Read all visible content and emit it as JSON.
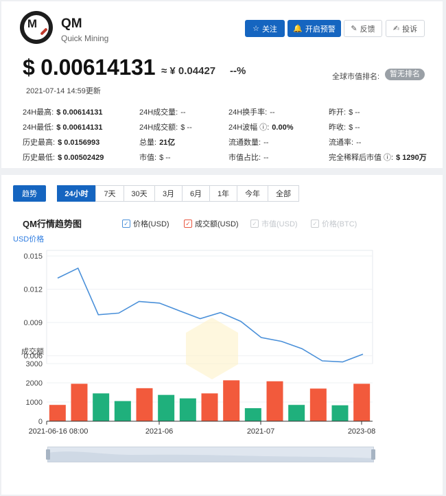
{
  "coin": {
    "symbol": "QM",
    "name": "Quick Mining",
    "logo_letter": "M"
  },
  "actions": [
    {
      "label": "关注",
      "icon": "☆",
      "name": "follow-button",
      "icon_name": "star-icon",
      "primary": true
    },
    {
      "label": "开启预警",
      "icon": "🔔",
      "name": "alert-button",
      "icon_name": "bell-icon",
      "primary": true
    },
    {
      "label": "反馈",
      "icon": "✎",
      "name": "feedback-button",
      "icon_name": "edit-icon",
      "primary": false
    },
    {
      "label": "投诉",
      "icon": "✍",
      "name": "complaint-button",
      "icon_name": "pen-icon",
      "primary": false
    }
  ],
  "price": {
    "usd": "$ 0.00614131",
    "cny": "≈ ¥ 0.04427",
    "change": "--%",
    "updated": "2021-07-14 14:59更新"
  },
  "rank": {
    "label": "全球市值排名:",
    "value": "暂无排名"
  },
  "stats": [
    [
      {
        "label": "24H最高:",
        "value": "$ 0.00614131",
        "bold": true
      },
      {
        "label": "24H成交量:",
        "value": "--"
      },
      {
        "label": "24H换手率:",
        "value": "--"
      },
      {
        "label": "昨开:",
        "value": "$ --"
      }
    ],
    [
      {
        "label": "24H最低:",
        "value": "$ 0.00614131",
        "bold": true
      },
      {
        "label": "24H成交额:",
        "value": "$ --"
      },
      {
        "label": "24H波幅 ⓘ:",
        "value": "0.00%",
        "bold": true
      },
      {
        "label": "昨收:",
        "value": "$ --"
      }
    ],
    [
      {
        "label": "历史最高:",
        "value": "$ 0.0156993",
        "bold": true
      },
      {
        "label": "总量:",
        "value": "21亿",
        "bold": true
      },
      {
        "label": "流通数量:",
        "value": "--"
      },
      {
        "label": "流通率:",
        "value": "--"
      }
    ],
    [
      {
        "label": "历史最低:",
        "value": "$ 0.00502429",
        "bold": true
      },
      {
        "label": "市值:",
        "value": "$ --"
      },
      {
        "label": "市值占比:",
        "value": "--"
      },
      {
        "label": "完全稀释后市值 ⓘ:",
        "value": "$ 1290万",
        "bold": true
      }
    ]
  ],
  "chart_tab": "趋势",
  "ranges": [
    "24小时",
    "7天",
    "30天",
    "3月",
    "6月",
    "1年",
    "今年",
    "全部"
  ],
  "active_range": "24小时",
  "chart_title": "QM行情趋势图",
  "legend": [
    {
      "label": "价格(USD)",
      "enabled": true,
      "color": "#4a90d9"
    },
    {
      "label": "成交额(USD)",
      "enabled": true,
      "color": "#e8553e"
    },
    {
      "label": "市值(USD)",
      "enabled": false
    },
    {
      "label": "价格(BTC)",
      "enabled": false
    }
  ],
  "colors": {
    "price_line": "#4a90d9",
    "bar_up": "#f25a3c",
    "bar_down": "#1fb07c",
    "accent": "#1565c0"
  },
  "chart_data": {
    "type": "line+bar",
    "price": {
      "ylabel": "USD价格",
      "yticks": [
        0.006,
        0.009,
        0.012,
        0.015
      ],
      "ylim": [
        0.0053,
        0.0155
      ],
      "values": [
        0.013,
        0.0139,
        0.0097,
        0.00985,
        0.0109,
        0.01075,
        0.01005,
        0.00935,
        0.0099,
        0.0091,
        0.00765,
        0.0073,
        0.00665,
        0.00555,
        0.00545,
        0.00615
      ]
    },
    "volume": {
      "ylabel": "成交额",
      "yticks": [
        0,
        1000,
        2000,
        3000
      ],
      "ylim": [
        0,
        3000
      ],
      "values": [
        850,
        1950,
        1450,
        1050,
        1720,
        1370,
        1190,
        1450,
        2130,
        680,
        2080,
        850,
        1700,
        830,
        1950
      ],
      "up": [
        true,
        true,
        false,
        false,
        true,
        false,
        false,
        true,
        true,
        false,
        true,
        false,
        true,
        false,
        true
      ]
    },
    "x_labels": [
      "2021-06-16 08:00",
      "2021-06",
      "2021-07",
      "2023-08"
    ],
    "grid": true
  }
}
